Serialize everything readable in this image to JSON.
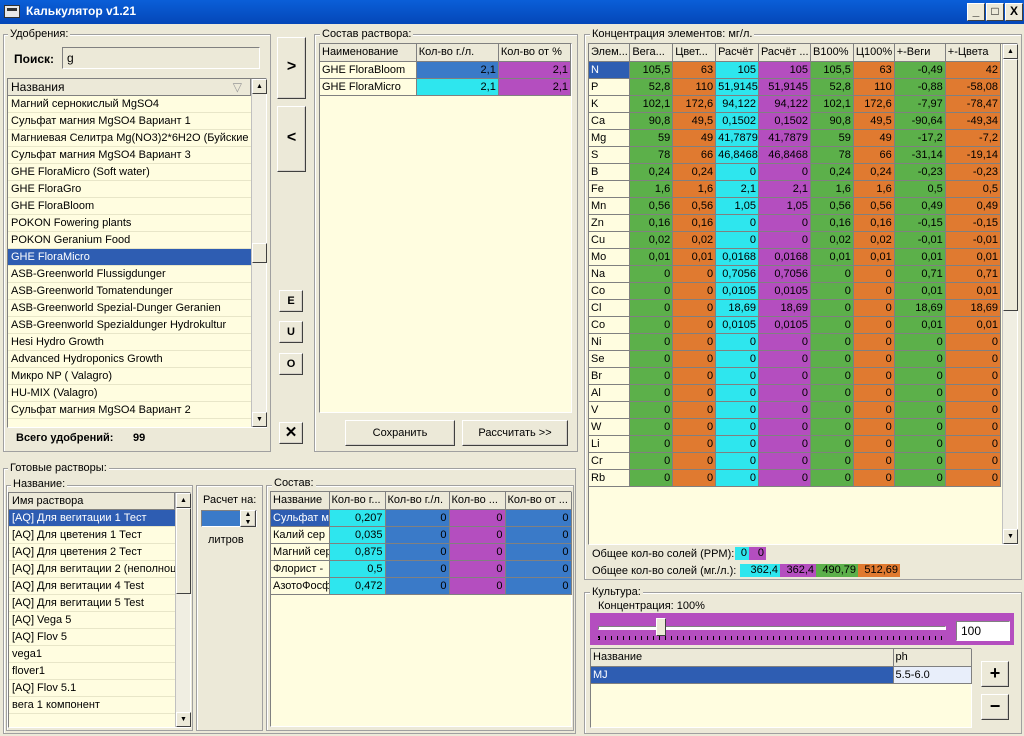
{
  "window": {
    "title": "Калькулятор v1.21",
    "controls": [
      "_",
      "□",
      "X"
    ]
  },
  "fertilizers": {
    "group": "Удобрения:",
    "search_label": "Поиск:",
    "search_value": "g",
    "col_header": "Названия",
    "items": [
      "Магний сернокислый MgSO4",
      "Сульфат магния MgSO4 Вариант 1",
      "Магниевая Селитра Mg(NO3)2*6H2O (Буйские у",
      "Сульфат магния MgSO4 Вариант 3",
      "GHE FloraMicro (Soft water)",
      "GHE FloraGro",
      "GHE FloraBloom",
      "POKON Fowering plants",
      "POKON Geranium Food",
      "GHE FloraMicro",
      "ASB-Greenworld Flussigdunger",
      "ASB-Greenworld Tomatendunger",
      "ASB-Greenworld Spezial-Dunger Geranien",
      "ASB-Greenworld Spezialdunger Hydrokultur",
      "Hesi Hydro Growth",
      "Advanced Hydroponics Growth",
      "Микро NP  ( Valagro)",
      "HU-MIX (Valagro)",
      "Сульфат магния MgSO4 Вариант 2"
    ],
    "selected_index": 9,
    "total_label": "Всего удобрений:",
    "total_value": "99"
  },
  "mid_buttons": {
    "add": ">",
    "remove": "<",
    "e": "E",
    "u": "U",
    "o": "O",
    "clear": "✕"
  },
  "composition": {
    "group": "Состав раствора:",
    "headers": [
      "Наименование",
      "Кол-во г./л.",
      "Кол-во от %"
    ],
    "rows": [
      {
        "name": "GHE FloraBloom",
        "g": "2,1",
        "pct": "2,1"
      },
      {
        "name": "GHE FloraMicro",
        "g": "2,1",
        "pct": "2,1"
      }
    ],
    "save": "Сохранить",
    "calc": "Рассчитать >>"
  },
  "concentration": {
    "group": "Концентрация элементов: мг/л.",
    "headers": [
      "Элем...",
      "Вега...",
      "Цвет...",
      "Расчёт",
      "Расчёт ...",
      "В100%",
      "Ц100%",
      "+-Веги",
      "+-Цвета"
    ],
    "rows": [
      [
        "N",
        "105,5",
        "63",
        "105",
        "105",
        "105,5",
        "63",
        "-0,49",
        "42"
      ],
      [
        "P",
        "52,8",
        "110",
        "51,9145",
        "51,9145",
        "52,8",
        "110",
        "-0,88",
        "-58,08"
      ],
      [
        "K",
        "102,1",
        "172,6",
        "94,122",
        "94,122",
        "102,1",
        "172,6",
        "-7,97",
        "-78,47"
      ],
      [
        "Ca",
        "90,8",
        "49,5",
        "0,1502",
        "0,1502",
        "90,8",
        "49,5",
        "-90,64",
        "-49,34"
      ],
      [
        "Mg",
        "59",
        "49",
        "41,7879",
        "41,7879",
        "59",
        "49",
        "-17,2",
        "-7,2"
      ],
      [
        "S",
        "78",
        "66",
        "46,8468",
        "46,8468",
        "78",
        "66",
        "-31,14",
        "-19,14"
      ],
      [
        "B",
        "0,24",
        "0,24",
        "0",
        "0",
        "0,24",
        "0,24",
        "-0,23",
        "-0,23"
      ],
      [
        "Fe",
        "1,6",
        "1,6",
        "2,1",
        "2,1",
        "1,6",
        "1,6",
        "0,5",
        "0,5"
      ],
      [
        "Mn",
        "0,56",
        "0,56",
        "1,05",
        "1,05",
        "0,56",
        "0,56",
        "0,49",
        "0,49"
      ],
      [
        "Zn",
        "0,16",
        "0,16",
        "0",
        "0",
        "0,16",
        "0,16",
        "-0,15",
        "-0,15"
      ],
      [
        "Cu",
        "0,02",
        "0,02",
        "0",
        "0",
        "0,02",
        "0,02",
        "-0,01",
        "-0,01"
      ],
      [
        "Mo",
        "0,01",
        "0,01",
        "0,0168",
        "0,0168",
        "0,01",
        "0,01",
        "0,01",
        "0,01"
      ],
      [
        "Na",
        "0",
        "0",
        "0,7056",
        "0,7056",
        "0",
        "0",
        "0,71",
        "0,71"
      ],
      [
        "Co",
        "0",
        "0",
        "0,0105",
        "0,0105",
        "0",
        "0",
        "0,01",
        "0,01"
      ],
      [
        "Cl",
        "0",
        "0",
        "18,69",
        "18,69",
        "0",
        "0",
        "18,69",
        "18,69"
      ],
      [
        "Co",
        "0",
        "0",
        "0,0105",
        "0,0105",
        "0",
        "0",
        "0,01",
        "0,01"
      ],
      [
        "Ni",
        "0",
        "0",
        "0",
        "0",
        "0",
        "0",
        "0",
        "0"
      ],
      [
        "Se",
        "0",
        "0",
        "0",
        "0",
        "0",
        "0",
        "0",
        "0"
      ],
      [
        "Br",
        "0",
        "0",
        "0",
        "0",
        "0",
        "0",
        "0",
        "0"
      ],
      [
        "Al",
        "0",
        "0",
        "0",
        "0",
        "0",
        "0",
        "0",
        "0"
      ],
      [
        "V",
        "0",
        "0",
        "0",
        "0",
        "0",
        "0",
        "0",
        "0"
      ],
      [
        "W",
        "0",
        "0",
        "0",
        "0",
        "0",
        "0",
        "0",
        "0"
      ],
      [
        "Li",
        "0",
        "0",
        "0",
        "0",
        "0",
        "0",
        "0",
        "0"
      ],
      [
        "Cr",
        "0",
        "0",
        "0",
        "0",
        "0",
        "0",
        "0",
        "0"
      ],
      [
        "Rb",
        "0",
        "0",
        "0",
        "0",
        "0",
        "0",
        "0",
        "0"
      ]
    ],
    "ppm_label": "Общее кол-во солей (PPM):",
    "ppm_values": [
      "0",
      "0"
    ],
    "mg_label": "Общее кол-во солей (мг./л.):",
    "mg_values": [
      "362,4",
      "362,4",
      "490,79",
      "512,69"
    ]
  },
  "ready": {
    "group": "Готовые растворы:",
    "name_label": "Название:",
    "col_header": "Имя раствора",
    "items": [
      "[AQ] Для вегитации 1 Тест",
      "[AQ] Для цветения 1 Тест",
      "[AQ] Для цветения 2 Тест",
      "[AQ] Для вегитации 2 (неполноц",
      "[AQ] Для вегитации 4 Test",
      "[AQ] Для вегитации 5 Test",
      "[AQ] Vega 5",
      "[AQ] Flov 5",
      "vega1",
      "flover1",
      "[AQ] Flov 5.1",
      "вега 1 компонент"
    ],
    "selected_index": 0,
    "calc_label": "Расчет на:",
    "calc_value": "",
    "liters": "литров"
  },
  "sostav": {
    "group": "Состав:",
    "headers": [
      "Название",
      "Кол-во г...",
      "Кол-во г./л.",
      "Кол-во ...",
      "Кол-во от ..."
    ],
    "rows": [
      [
        "Сульфат м",
        "0,207",
        "0",
        "0",
        "0"
      ],
      [
        "Калий сер",
        "0,035",
        "0",
        "0",
        "0"
      ],
      [
        "Магний сер",
        "0,875",
        "0",
        "0",
        "0"
      ],
      [
        "Флорист -",
        "0,5",
        "0",
        "0",
        "0"
      ],
      [
        "АзотоФосф",
        "0,472",
        "0",
        "0",
        "0"
      ]
    ]
  },
  "culture": {
    "group": "Культура:",
    "conc_label": "Концентрация: 100%",
    "slider_pct": 18,
    "value": "100",
    "headers": [
      "Название",
      "ph"
    ],
    "rows": [
      [
        "MJ",
        "5.5-6.0"
      ]
    ],
    "plus": "+",
    "minus": "−"
  }
}
